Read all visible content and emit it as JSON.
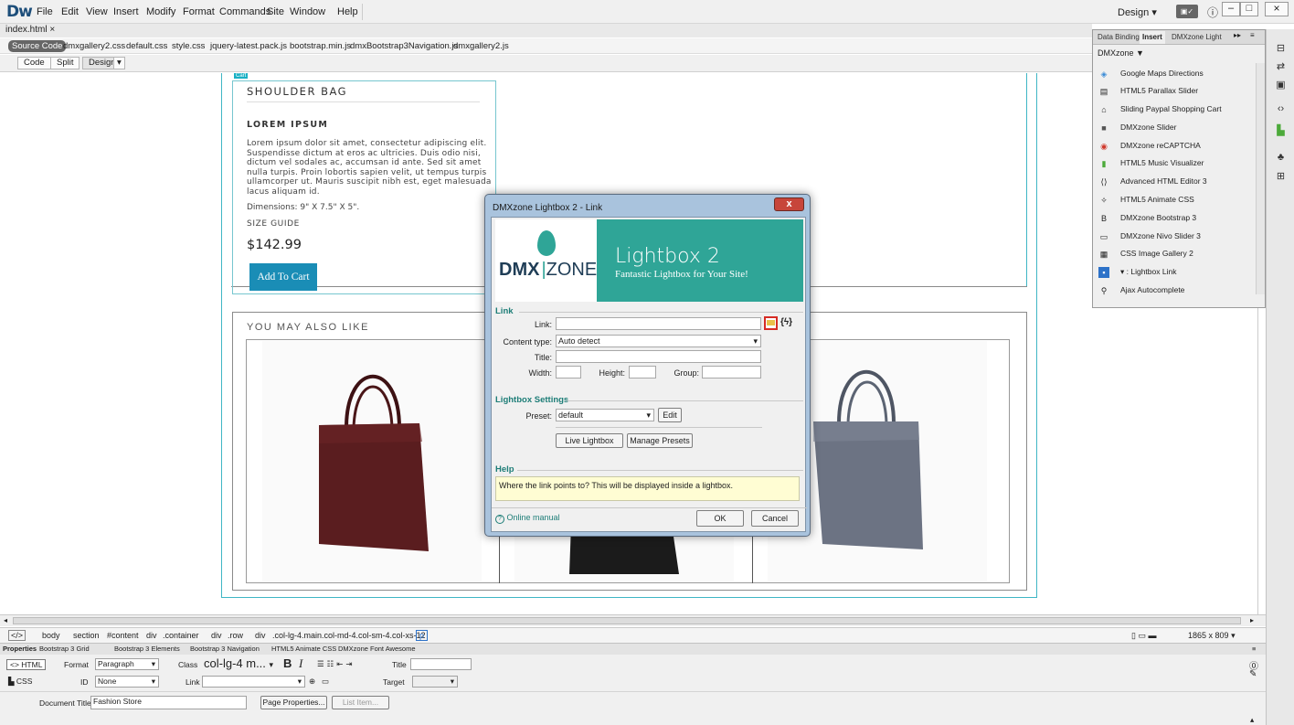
{
  "app": {
    "logo": "Dw",
    "menu": [
      "File",
      "Edit",
      "View",
      "Insert",
      "Modify",
      "Format",
      "Commands",
      "Site",
      "Window",
      "Help"
    ],
    "workspace": "Design",
    "window_controls": [
      "–",
      "□",
      "×"
    ]
  },
  "document": {
    "tab": "index.html",
    "tab_close": "×",
    "related_files": [
      "Source Code",
      "dmxgallery2.css",
      "default.css",
      "style.css",
      "jquery-latest.pack.js",
      "bootstrap.min.js",
      "dmxBootstrap3Navigation.js",
      "dmxgallery2.js"
    ],
    "views": [
      "Code",
      "Split",
      "Design"
    ]
  },
  "page": {
    "cart_tag": "Cart",
    "product_title": "SHOULDER BAG",
    "product_subtitle": "LOREM IPSUM",
    "description": "Lorem ipsum dolor sit amet, consectetur adipiscing elit. Suspendisse dictum at eros ac ultricies. Duis odio nisi, dictum vel sodales ac, accumsan id ante. Sed sit amet nulla turpis. Proin lobortis sapien velit, ut tempus turpis ullamcorper ut. Mauris suscipit nibh est, eget malesuada lacus aliquam id.",
    "dimensions": "Dimensions: 9\" X 7.5\" X 5\".",
    "size_guide": "SIZE GUIDE",
    "price": "$142.99",
    "add_to_cart": "Add To Cart",
    "also_like": "YOU MAY ALSO LIKE",
    "bag_colors": [
      "#5a1d1f",
      "#1b1b1b",
      "#6c7383"
    ]
  },
  "dialog": {
    "title": "DMXzone Lightbox 2 - Link",
    "close": "x",
    "banner_logo_a": "DMX",
    "banner_logo_b": "ZONE",
    "banner_title": "Lightbox 2",
    "banner_subtitle": "Fantastic Lightbox for Your Site!",
    "section_link": "Link",
    "link_label": "Link:",
    "link_value": "",
    "content_type_label": "Content type:",
    "content_type_value": "Auto detect",
    "title_label": "Title:",
    "width_label": "Width:",
    "height_label": "Height:",
    "group_label": "Group:",
    "section_settings": "Lightbox Settings",
    "preset_label": "Preset:",
    "preset_value": "default",
    "edit_button": "Edit",
    "live_button": "Live Lightbox",
    "manage_button": "Manage Presets",
    "section_help": "Help",
    "help_text": "Where the link points to? This will be displayed inside a lightbox.",
    "manual_link": "Online manual",
    "ok_button": "OK",
    "cancel_button": "Cancel"
  },
  "insert_panel": {
    "tabs": [
      "Data Bindings",
      "Insert",
      "DMXzone Light"
    ],
    "category": "DMXzone ▼",
    "items": [
      "Google Maps Directions",
      "HTML5 Parallax Slider",
      "Sliding Paypal Shopping Cart",
      "DMXzone Slider",
      "DMXzone reCAPTCHA",
      "HTML5 Music Visualizer",
      "Advanced HTML Editor 3",
      "HTML5 Animate CSS",
      "DMXzone Bootstrap 3",
      "DMXzone Nivo Slider 3",
      "CSS Image Gallery 2",
      "▾ : Lightbox Link",
      "Ajax Autocomplete"
    ]
  },
  "tagbar": {
    "code_icon": "</>",
    "tags": [
      "body",
      "section",
      "#content",
      "div",
      ".container",
      "div",
      ".row",
      "div",
      ".col-lg-4.main.col-md-4.col-sm-4.col-xs-12",
      "p"
    ],
    "size": "1865 x 809"
  },
  "properties": {
    "tabs": [
      "Properties",
      "Bootstrap 3 Grid",
      "Bootstrap 3 Elements",
      "Bootstrap 3 Navigation",
      "HTML5 Animate CSS",
      "DMXzone Font Awesome"
    ],
    "html_btn": "<> HTML",
    "css_btn": "CSS",
    "format_label": "Format",
    "format_value": "Paragraph",
    "class_label": "Class",
    "class_value": "col-lg-4 m...",
    "bold": "B",
    "italic": "I",
    "title_label": "Title",
    "id_label": "ID",
    "id_value": "None",
    "link_label": "Link",
    "target_label": "Target",
    "doc_title_label": "Document Title",
    "doc_title_value": "Fashion Store",
    "page_props": "Page Properties...",
    "list_item": "List Item..."
  }
}
